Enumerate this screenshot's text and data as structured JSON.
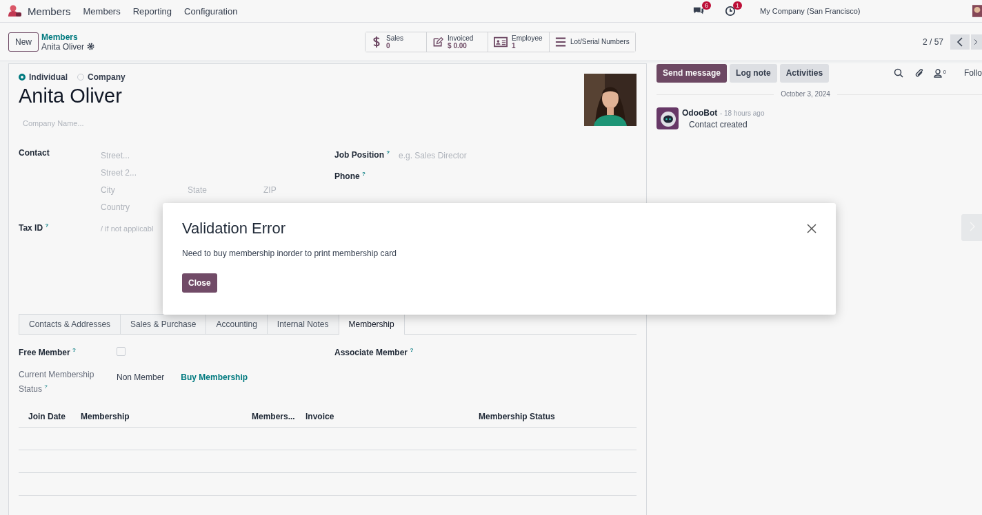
{
  "navbar": {
    "app": "Members",
    "menus": [
      "Members",
      "Reporting",
      "Configuration"
    ],
    "messages_badge": "6",
    "activities_badge": "1",
    "company": "My Company (San Francisco)"
  },
  "control_panel": {
    "new_button": "New",
    "breadcrumb": "Members",
    "record": "Anita Oliver",
    "pager": "2 / 57",
    "smart_buttons": [
      {
        "kind": "dollar",
        "label": "Sales",
        "value": "0"
      },
      {
        "kind": "edit",
        "label": "Invoiced",
        "value": "$ 0.00"
      },
      {
        "kind": "card",
        "label": "Employee",
        "value": "1"
      },
      {
        "kind": "list",
        "label": "Lot/Serial Numbers"
      }
    ]
  },
  "form": {
    "type_options": [
      {
        "label": "Individual",
        "selected": true
      },
      {
        "label": "Company",
        "selected": false
      }
    ],
    "name": "Anita Oliver",
    "company_placeholder": "Company Name...",
    "contact": {
      "label": "Contact",
      "street_placeholder": "Street...",
      "street2_placeholder": "Street 2...",
      "city_placeholder": "City",
      "state_placeholder": "State",
      "zip_placeholder": "ZIP",
      "country_placeholder": "Country"
    },
    "tax": {
      "label": "Tax ID",
      "help": "?",
      "placeholder": "/ if not applicabl"
    },
    "job": {
      "label": "Job Position",
      "help": "?",
      "placeholder": "e.g. Sales Director"
    },
    "phone": {
      "label": "Phone",
      "help": "?"
    },
    "tabs": [
      {
        "label": "Contacts & Addresses",
        "selected": false
      },
      {
        "label": "Sales & Purchase",
        "selected": false
      },
      {
        "label": "Accounting",
        "selected": false
      },
      {
        "label": "Internal Notes",
        "selected": false
      },
      {
        "label": "Membership",
        "selected": true
      }
    ],
    "membership": {
      "free_member": {
        "label": "Free Member",
        "help": "?",
        "checked": false
      },
      "associate": {
        "label": "Associate Member",
        "help": "?"
      },
      "status": {
        "label": "Current Membership Status",
        "help": "?",
        "value": "Non Member",
        "link": "Buy Membership"
      },
      "columns": [
        "Join Date",
        "Membership",
        "Members...",
        "Invoice",
        "Membership Status"
      ]
    }
  },
  "chatter": {
    "buttons": [
      {
        "label": "Send message",
        "selected": true
      },
      {
        "label": "Log note",
        "selected": false
      },
      {
        "label": "Activities",
        "selected": false
      }
    ],
    "followers_count": "0",
    "follow": "Follo",
    "date": "October 3, 2024",
    "messages": [
      {
        "author": "OdooBot",
        "time": "- 18 hours ago",
        "body": "Contact created"
      }
    ]
  },
  "dialog": {
    "title": "Validation Error",
    "body": "Need to buy membership inorder to print membership card",
    "button": "Close"
  }
}
